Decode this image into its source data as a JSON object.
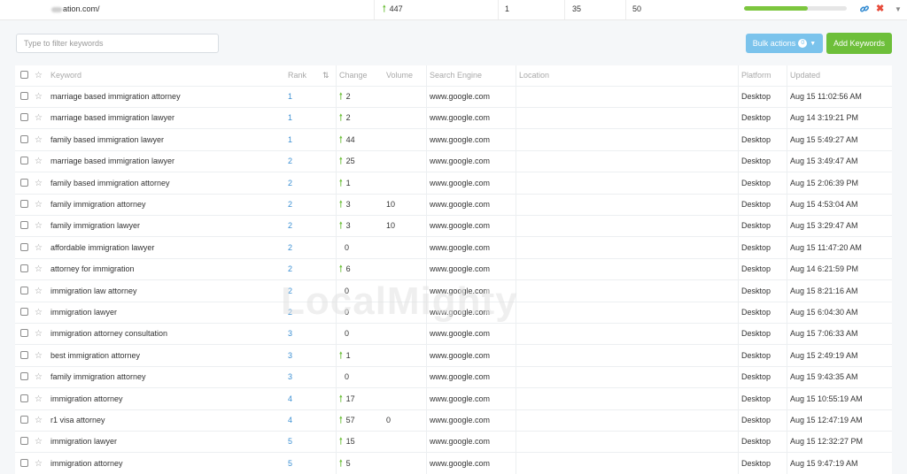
{
  "top": {
    "url_suffix": "ation.com/",
    "change": "447",
    "c1": "1",
    "c2": "35",
    "c3": "50",
    "progress_percent": 62
  },
  "filter": {
    "placeholder": "Type to filter keywords"
  },
  "buttons": {
    "bulk": "Bulk actions",
    "bulk_count": "0",
    "add": "Add Keywords"
  },
  "columns": {
    "keyword": "Keyword",
    "rank": "Rank",
    "change": "Change",
    "volume": "Volume",
    "engine": "Search Engine",
    "location": "Location",
    "platform": "Platform",
    "updated": "Updated"
  },
  "rows": [
    {
      "kw": "marriage based immigration attorney",
      "rank": "1",
      "chg": "2",
      "up": true,
      "vol": "",
      "se": "www.google.com",
      "plat": "Desktop",
      "upd": "Aug 15 11:02:56 AM"
    },
    {
      "kw": "marriage based immigration lawyer",
      "rank": "1",
      "chg": "2",
      "up": true,
      "vol": "",
      "se": "www.google.com",
      "plat": "Desktop",
      "upd": "Aug 14 3:19:21 PM"
    },
    {
      "kw": "family based immigration lawyer",
      "rank": "1",
      "chg": "44",
      "up": true,
      "vol": "",
      "se": "www.google.com",
      "plat": "Desktop",
      "upd": "Aug 15 5:49:27 AM"
    },
    {
      "kw": "marriage based immigration lawyer",
      "rank": "2",
      "chg": "25",
      "up": true,
      "vol": "",
      "se": "www.google.com",
      "plat": "Desktop",
      "upd": "Aug 15 3:49:47 AM"
    },
    {
      "kw": "family based immigration attorney",
      "rank": "2",
      "chg": "1",
      "up": true,
      "vol": "",
      "se": "www.google.com",
      "plat": "Desktop",
      "upd": "Aug 15 2:06:39 PM"
    },
    {
      "kw": "family immigration attorney",
      "rank": "2",
      "chg": "3",
      "up": true,
      "vol": "10",
      "se": "www.google.com",
      "plat": "Desktop",
      "upd": "Aug 15 4:53:04 AM"
    },
    {
      "kw": "family immigration lawyer",
      "rank": "2",
      "chg": "3",
      "up": true,
      "vol": "10",
      "se": "www.google.com",
      "plat": "Desktop",
      "upd": "Aug 15 3:29:47 AM"
    },
    {
      "kw": "affordable immigration lawyer",
      "rank": "2",
      "chg": "0",
      "up": false,
      "vol": "",
      "se": "www.google.com",
      "plat": "Desktop",
      "upd": "Aug 15 11:47:20 AM"
    },
    {
      "kw": "attorney for immigration",
      "rank": "2",
      "chg": "6",
      "up": true,
      "vol": "",
      "se": "www.google.com",
      "plat": "Desktop",
      "upd": "Aug 14 6:21:59 PM"
    },
    {
      "kw": "immigration law attorney",
      "rank": "2",
      "chg": "0",
      "up": false,
      "vol": "",
      "se": "www.google.com",
      "plat": "Desktop",
      "upd": "Aug 15 8:21:16 AM"
    },
    {
      "kw": "immigration lawyer",
      "rank": "2",
      "chg": "0",
      "up": false,
      "vol": "",
      "se": "www.google.com",
      "plat": "Desktop",
      "upd": "Aug 15 6:04:30 AM"
    },
    {
      "kw": "immigration attorney consultation",
      "rank": "3",
      "chg": "0",
      "up": false,
      "vol": "",
      "se": "www.google.com",
      "plat": "Desktop",
      "upd": "Aug 15 7:06:33 AM"
    },
    {
      "kw": "best immigration attorney",
      "rank": "3",
      "chg": "1",
      "up": true,
      "vol": "",
      "se": "www.google.com",
      "plat": "Desktop",
      "upd": "Aug 15 2:49:19 AM"
    },
    {
      "kw": "family immigration attorney",
      "rank": "3",
      "chg": "0",
      "up": false,
      "vol": "",
      "se": "www.google.com",
      "plat": "Desktop",
      "upd": "Aug 15 9:43:35 AM"
    },
    {
      "kw": "immigration attorney",
      "rank": "4",
      "chg": "17",
      "up": true,
      "vol": "",
      "se": "www.google.com",
      "plat": "Desktop",
      "upd": "Aug 15 10:55:19 AM"
    },
    {
      "kw": "r1 visa attorney",
      "rank": "4",
      "chg": "57",
      "up": true,
      "vol": "0",
      "se": "www.google.com",
      "plat": "Desktop",
      "upd": "Aug 15 12:47:19 AM"
    },
    {
      "kw": "immigration lawyer",
      "rank": "5",
      "chg": "15",
      "up": true,
      "vol": "",
      "se": "www.google.com",
      "plat": "Desktop",
      "upd": "Aug 15 12:32:27 PM"
    },
    {
      "kw": "immigration attorney",
      "rank": "5",
      "chg": "5",
      "up": true,
      "vol": "",
      "se": "www.google.com",
      "plat": "Desktop",
      "upd": "Aug 15 9:47:19 AM"
    }
  ],
  "watermark": "LocalMighty",
  "colors": {
    "accent_blue": "#3a8fd3",
    "up_green": "#6dbf3a",
    "bulk_btn": "#7bc3ec",
    "add_btn": "#6dbf3a",
    "delete_red": "#e74c3c"
  },
  "icons": {
    "up": "arrow-up-icon",
    "star": "star-icon",
    "link": "link-icon",
    "delete": "close-icon",
    "sort": "sort-icon"
  }
}
